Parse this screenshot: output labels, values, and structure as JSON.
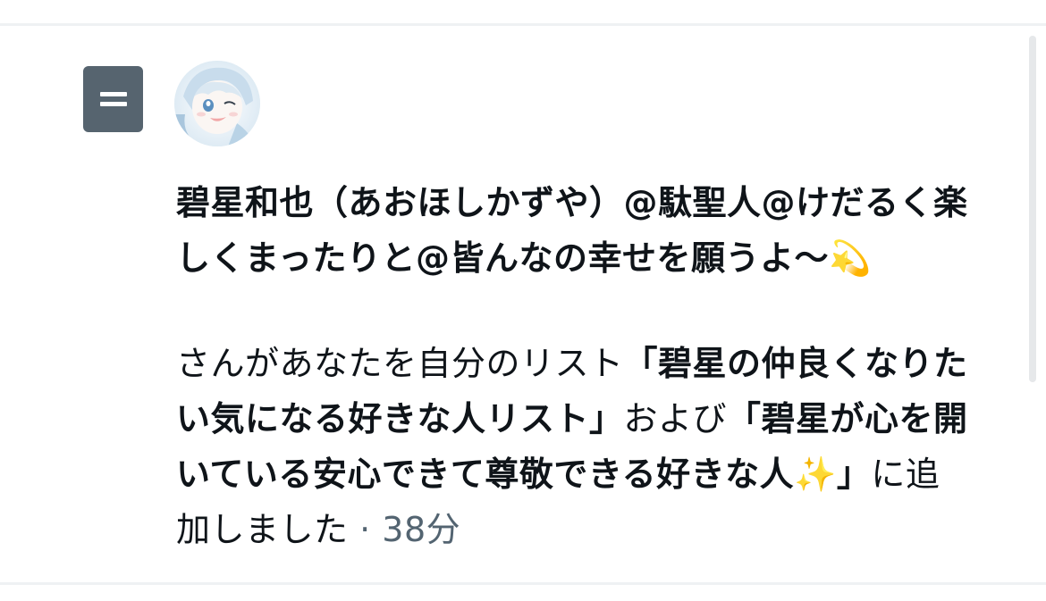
{
  "notification": {
    "display_name": "碧星和也（あおほしかずや）@駄聖人@けだるく楽しくまったりと@皆んなの幸せを願うよ〜💫",
    "message_prefix": "さんがあなたを自分のリスト",
    "list_1": "「碧星の仲良くなりたい気になる好きな人リスト」",
    "connector": "および",
    "list_2": "「碧星が心を開いている安心できて尊敬できる好きな人✨」",
    "message_suffix": "に追加しました",
    "separator": " · ",
    "time": "38分",
    "icon": "list-icon",
    "avatar": "user-avatar"
  },
  "colors": {
    "text": "#0f1419",
    "secondary": "#536471",
    "icon_bg": "#56646f",
    "divider": "#eff1f3"
  }
}
